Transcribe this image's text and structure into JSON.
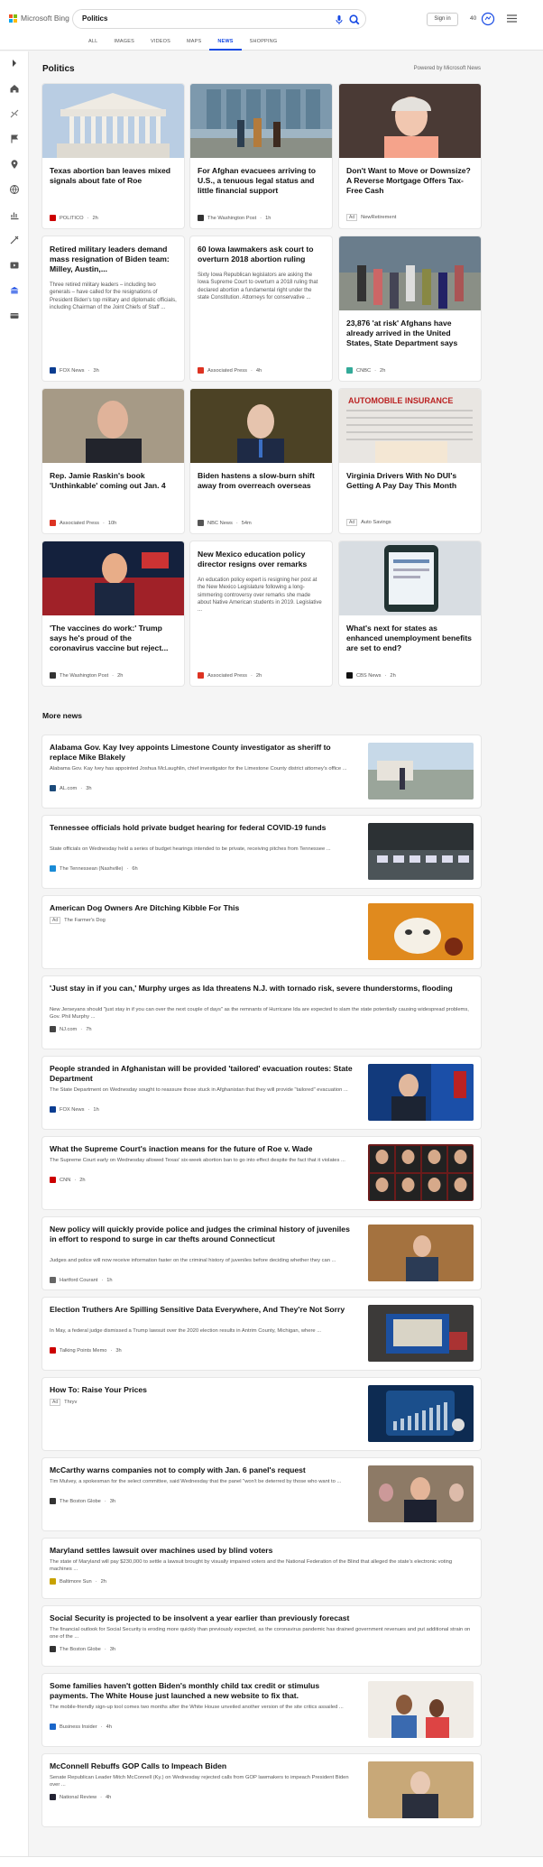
{
  "header": {
    "brand": "Microsoft Bing",
    "query": "Politics",
    "signin": "Sign in",
    "points": "40",
    "tabs": [
      "ALL",
      "IMAGES",
      "VIDEOS",
      "MAPS",
      "NEWS",
      "SHOPPING"
    ],
    "active_tab": "NEWS"
  },
  "section": {
    "title": "Politics",
    "powered": "Powered by Microsoft News"
  },
  "cards": [
    {
      "title": "Texas abortion ban leaves mixed signals about fate of Roe",
      "snippet": "",
      "source": "POLITICO",
      "time": "2h",
      "ad": false,
      "fav": "#c00"
    },
    {
      "title": "For Afghan evacuees arriving to U.S., a tenuous legal status and little financial support",
      "snippet": "",
      "source": "The Washington Post",
      "time": "1h",
      "ad": false,
      "fav": "#333"
    },
    {
      "title": "Don't Want to Move or Downsize? A Reverse Mortgage Offers Tax-Free Cash",
      "snippet": "",
      "source": "NewRetirement",
      "time": "",
      "ad": true,
      "fav": ""
    },
    {
      "title": "Retired military leaders demand mass resignation of Biden team: Milley, Austin,...",
      "snippet": "Three retired military leaders – including two generals – have called for the resignations of President Biden's top military and diplomatic officials, including Chairman of the Joint Chiefs of Staff ...",
      "source": "FOX News",
      "time": "3h",
      "ad": false,
      "fav": "#0b3d91"
    },
    {
      "title": "60 Iowa lawmakers ask court to overturn 2018 abortion ruling",
      "snippet": "Sixty Iowa Republican legislators are asking the Iowa Supreme Court to overturn a 2018 ruling that declared abortion a fundamental right under the state Constitution. Attorneys for conservative ...",
      "source": "Associated Press",
      "time": "4h",
      "ad": false,
      "fav": "#d32"
    },
    {
      "title": "23,876 'at risk' Afghans have already arrived in the United States, State Department says",
      "snippet": "",
      "source": "CNBC",
      "time": "2h",
      "ad": false,
      "fav": "#3a9"
    },
    {
      "title": "Rep. Jamie Raskin's book 'Unthinkable' coming out Jan. 4",
      "snippet": "",
      "source": "Associated Press",
      "time": "10h",
      "ad": false,
      "fav": "#d32"
    },
    {
      "title": "Biden hastens a slow-burn shift away from overreach overseas",
      "snippet": "",
      "source": "NBC News",
      "time": "54m",
      "ad": false,
      "fav": "#555"
    },
    {
      "title": "Virginia Drivers With No DUI's Getting A Pay Day This Month",
      "snippet": "",
      "source": "Auto Savings",
      "time": "",
      "ad": true,
      "fav": ""
    },
    {
      "title": "'The vaccines do work:' Trump says he's proud of the coronavirus vaccine but reject...",
      "snippet": "",
      "source": "The Washington Post",
      "time": "2h",
      "ad": false,
      "fav": "#333"
    },
    {
      "title": "New Mexico education policy director resigns over remarks",
      "snippet": "An education policy expert is resigning her post at the New Mexico Legislature following a long-simmering controversy over remarks she made about Native American students in 2019. Legislative ...",
      "source": "Associated Press",
      "time": "2h",
      "ad": false,
      "fav": "#d32"
    },
    {
      "title": "What's next for states as enhanced unemployment benefits are set to end?",
      "snippet": "",
      "source": "CBS News",
      "time": "2h",
      "ad": false,
      "fav": "#111"
    }
  ],
  "more_news_title": "More news",
  "rows": [
    {
      "title": "Alabama Gov. Kay Ivey appoints Limestone County investigator as sheriff to replace Mike Blakely",
      "snippet": "Alabama Gov. Kay Ivey has appointed Joshua McLaughlin, chief investigator for the Limestone County district attorney's office ...",
      "source": "AL.com",
      "time": "3h",
      "ad": false,
      "fav": "#1b4a7a",
      "thumb": "street"
    },
    {
      "title": "Tennessee officials hold private budget hearing for federal COVID-19 funds",
      "snippet": "State officials on Wednesday held a series of budget hearings intended to be private, receiving pitches from Tennessee ...",
      "source": "The Tennessean (Nashville)",
      "time": "6h",
      "ad": false,
      "fav": "#1a8bd6",
      "thumb": "room"
    },
    {
      "title": "American Dog Owners Are Ditching Kibble For This",
      "snippet": "",
      "source": "The Farmer's Dog",
      "time": "",
      "ad": true,
      "fav": "",
      "thumb": "dog"
    },
    {
      "title": "'Just stay in if you can,' Murphy urges as Ida threatens N.J. with tornado risk, severe thunderstorms, flooding",
      "snippet": "New Jerseyans should \"just stay in if you can over the next couple of days\" as the remnants of Hurricane Ida are expected to slam the state potentially causing widespread problems, Gov. Phil Murphy ...",
      "source": "NJ.com",
      "time": "7h",
      "ad": false,
      "fav": "#444",
      "thumb": ""
    },
    {
      "title": "People stranded in Afghanistan will be provided 'tailored' evacuation routes: State Department",
      "snippet": "The State Department on Wednesday sought to reassure those stuck in Afghanistan that they will provide \"tailored\" evacuation ...",
      "source": "FOX News",
      "time": "1h",
      "ad": false,
      "fav": "#0b3d91",
      "thumb": "podium"
    },
    {
      "title": "What the Supreme Court's inaction means for the future of Roe v. Wade",
      "snippet": "The Supreme Court early on Wednesday allowed Texas' six-week abortion ban to go into effect despite the fact that it violates ...",
      "source": "CNN",
      "time": "2h",
      "ad": false,
      "fav": "#c00",
      "thumb": "justices"
    },
    {
      "title": "New policy will quickly provide police and judges the criminal history of juveniles in effort to respond to surge in car thefts around Connecticut",
      "snippet": "Judges and police will now receive information faster on the criminal history of juveniles before deciding whether they can ...",
      "source": "Hartford Courant",
      "time": "1h",
      "ad": false,
      "fav": "#666",
      "thumb": "official"
    },
    {
      "title": "Election Truthers Are Spilling Sensitive Data Everywhere, And They're Not Sorry",
      "snippet": "In May, a federal judge dismissed a Trump lawsuit over the 2020 election results in Antrim County, Michigan, where ...",
      "source": "Talking Points Memo",
      "time": "3h",
      "ad": false,
      "fav": "#c00",
      "thumb": "machine"
    },
    {
      "title": "How To: Raise Your Prices",
      "snippet": "",
      "source": "Thryv",
      "time": "",
      "ad": true,
      "fav": "",
      "thumb": "phone"
    },
    {
      "title": "McCarthy warns companies not to comply with Jan. 6 panel's request",
      "snippet": "Tim Mulvey, a spokesman for the select committee, said Wednesday that the panel \"won't be deterred by those who want to ...",
      "source": "The Boston Globe",
      "time": "3h",
      "ad": false,
      "fav": "#333",
      "thumb": "crowd"
    },
    {
      "title": "Maryland settles lawsuit over machines used by blind voters",
      "snippet": "The state of Maryland will pay $230,000 to settle a lawsuit brought by visually impaired voters and the National Federation of the Blind that alleged the state's electronic voting machines ...",
      "source": "Baltimore Sun",
      "time": "2h",
      "ad": false,
      "fav": "#c8a200",
      "thumb": ""
    },
    {
      "title": "Social Security is projected to be insolvent a year earlier than previously forecast",
      "snippet": "The financial outlook for Social Security is eroding more quickly than previously expected, as the coronavirus pandemic has drained government revenues and put additional strain on one of the ...",
      "source": "The Boston Globe",
      "time": "3h",
      "ad": false,
      "fav": "#333",
      "thumb": ""
    },
    {
      "title": "Some families haven't gotten Biden's monthly child tax credit or stimulus payments. The White House just launched a new website to fix that.",
      "snippet": "The mobile-friendly sign-up tool comes two months after the White House unveiled another version of the site critics assailed ...",
      "source": "Business Insider",
      "time": "4h",
      "ad": false,
      "fav": "#1a66c9",
      "thumb": "family"
    },
    {
      "title": "McConnell Rebuffs GOP Calls to Impeach Biden",
      "snippet": "Senate Republican Leader Mitch McConnell (Ky.) on Wednesday rejected calls from GOP lawmakers to impeach President Biden over ...",
      "source": "National Review",
      "time": "4h",
      "ad": false,
      "fav": "#223",
      "thumb": "mcconnell"
    }
  ],
  "ad_label": "Ad"
}
